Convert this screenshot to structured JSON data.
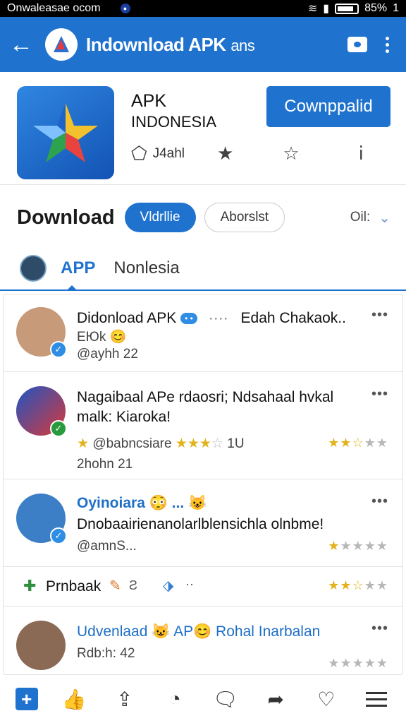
{
  "status_bar": {
    "carrier": "Onwaleasae ocom",
    "battery": "85%",
    "battery_extra": "1"
  },
  "app_bar": {
    "title": "Indownload APK",
    "title_suffix": "ans",
    "icons": [
      "back-arrow-icon",
      "logo-icon",
      "chat-icon",
      "more-vert-icon"
    ]
  },
  "app_header": {
    "name_line1": "APK",
    "name_line2": "INDONESIA",
    "install_label": "Cownppalid",
    "size": "J4ahl"
  },
  "download_row": {
    "heading": "Download",
    "chip_active": "Vldrllie",
    "chip_outline": "Aborslst",
    "sort_label": "Oil:"
  },
  "tabs": {
    "app": "APP",
    "second": "Nonlesia"
  },
  "feed": [
    {
      "title": "Didonload APK",
      "badge": "• •",
      "dots": "····",
      "title_right": "Edah Chakaok..",
      "sub": "EЮk 😊",
      "meta": "@ayhh 22"
    },
    {
      "line1": "Nagaibaal APe rdaosri; Ndsahaal hvkal",
      "line2": "malk: Kiaroka!",
      "rating_row": "@babncsiare",
      "rating_num": "1U",
      "time": "2hohn 21",
      "stars": 2.5
    },
    {
      "name": "Oyinoiara 😳 ... 😺",
      "text": "Dnobaairienanolarlblensichla olnbme!",
      "meta": "@amnS...",
      "stars": 1.5
    },
    {
      "label": "Prnbaak",
      "stars": 2.5
    },
    {
      "title": "Udvenlaad 😺 AP😊 Rohal Inarbalan",
      "meta": "Rdb:h: 42",
      "stars": 0
    }
  ]
}
